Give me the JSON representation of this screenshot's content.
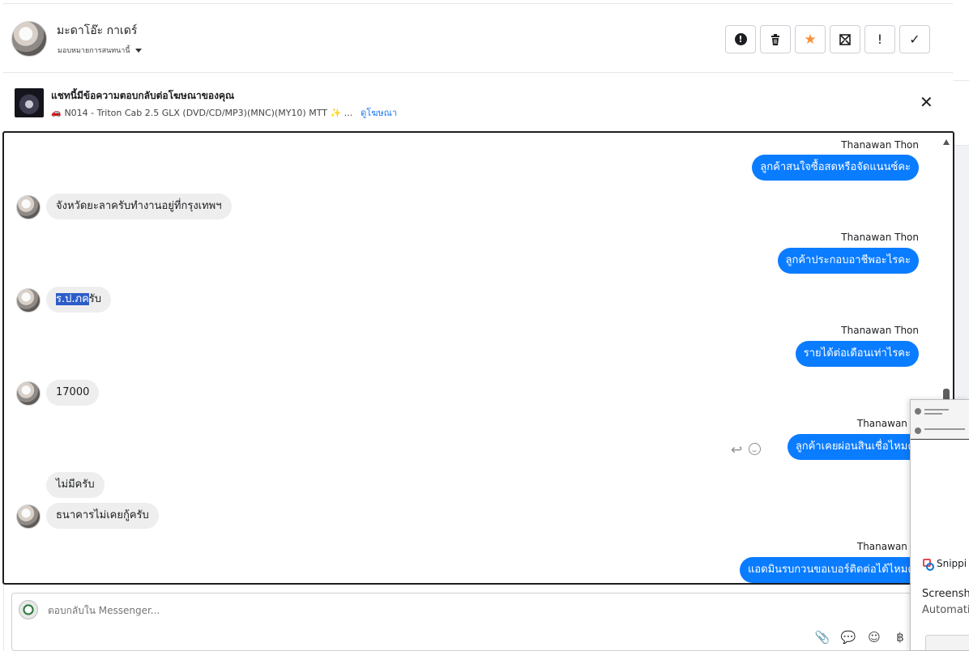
{
  "header": {
    "contact_name": "มะดาโอ๊ะ กาเดร์",
    "assign_label": "มอบหมายการสนทนานี้",
    "actions": [
      {
        "name": "spam-button",
        "icon": "exclamation-circle-icon",
        "glyph": "!"
      },
      {
        "name": "delete-button",
        "icon": "trash-icon",
        "glyph": "🗑"
      },
      {
        "name": "star-button",
        "icon": "star-icon",
        "glyph": "★"
      },
      {
        "name": "mark-unread-button",
        "icon": "envelope-icon",
        "glyph": "✉"
      },
      {
        "name": "follow-up-button",
        "icon": "exclamation-icon",
        "glyph": "!"
      },
      {
        "name": "done-button",
        "icon": "check-icon",
        "glyph": "✓"
      }
    ]
  },
  "ad_banner": {
    "title": "แชทนี้มีข้อความตอบกลับต่อโฆษณาของคุณ",
    "subtitle": "N014 - Triton Cab 2.5 GLX (DVD/CD/MP3)(MNC)(MY10) MTT ✨ ...",
    "link": "ดูโฆษณา",
    "car_glyph": "🚗"
  },
  "messages": [
    {
      "sender": "Thanawan Thon",
      "text": "ลูกค้าสนใจซื้อสดหรือจัดแนนซ์คะ"
    },
    {
      "text": "จังหวัดยะลาครับทำงานอยู่ที่กรุงเทพฯ"
    },
    {
      "sender": "Thanawan Thon",
      "text": "ลูกค้าประกอบอาชีพอะไรคะ"
    },
    {
      "text_highlight": "ร.ป.ภค",
      "text_rest": "รับ"
    },
    {
      "sender": "Thanawan Thon",
      "text": "รายได้ต่อเดือนเท่าไรคะ"
    },
    {
      "text": "17000"
    },
    {
      "sender": "Thanawan Tho",
      "text": "ลูกค้าเคยผ่อนสินเชื่อไหมคะ"
    },
    {
      "text": "ไม่มีครับ"
    },
    {
      "text": "ธนาคารไม่เคยกู้ครับ"
    },
    {
      "sender": "Thanawan Tho",
      "text": "แอดมินรบกวนขอเบอร์ติดต่อได้ไหมคะ"
    }
  ],
  "composer": {
    "placeholder": "ตอบกลับใน Messenger...",
    "tools": [
      {
        "name": "attach-icon",
        "glyph": "📎"
      },
      {
        "name": "saved-reply-icon",
        "glyph": "💬"
      },
      {
        "name": "emoji-picker-icon",
        "glyph": "☺"
      },
      {
        "name": "payment-icon",
        "glyph": "฿"
      }
    ]
  },
  "snip": {
    "app_name": "Snippi",
    "title": "Screensho",
    "desc": "Automati"
  },
  "colors": {
    "outgoing_bubble": "#0a7cff",
    "incoming_bubble": "#eeeeee",
    "star": "#f7923a",
    "link": "#1877f2"
  }
}
